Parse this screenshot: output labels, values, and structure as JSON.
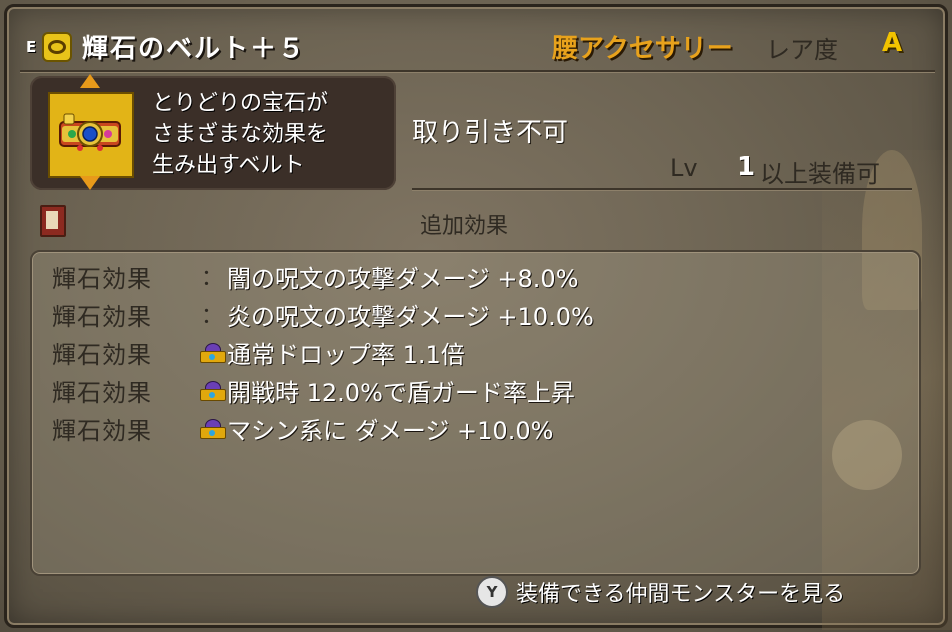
{
  "item": {
    "equipped_mark": "E",
    "name": "輝石のベルト＋５",
    "category": "腰アクセサリー",
    "rarity_label": "レア度",
    "rarity": "A",
    "description": "とりどりの宝石が\nさまざまな効果を\n生み出すベルト",
    "trade_status": "取り引き不可",
    "level_label": "Lv",
    "level_value": "1",
    "level_text": "以上装備可"
  },
  "extra_effects": {
    "title": "追加効果",
    "rows": [
      {
        "label": "輝石効果",
        "separator": "：",
        "icon": null,
        "text": "闇の呪文の攻撃ダメージ +8.0%"
      },
      {
        "label": "輝石効果",
        "separator": "：",
        "icon": null,
        "text": "炎の呪文の攻撃ダメージ +10.0%"
      },
      {
        "label": "輝石効果",
        "separator": null,
        "icon": "crown-icon",
        "text": "通常ドロップ率 1.1倍"
      },
      {
        "label": "輝石効果",
        "separator": null,
        "icon": "crown-icon",
        "text": "開戦時 12.0%で盾ガード率上昇"
      },
      {
        "label": "輝石効果",
        "separator": null,
        "icon": "crown-icon",
        "text": "マシン系に ダメージ +10.0%"
      }
    ]
  },
  "footer": {
    "button": "Y",
    "text": "装備できる仲間モンスターを見る"
  },
  "colors": {
    "category": "#e8a21c",
    "rarity": "#f2c300",
    "parchment": "#6d6453"
  }
}
